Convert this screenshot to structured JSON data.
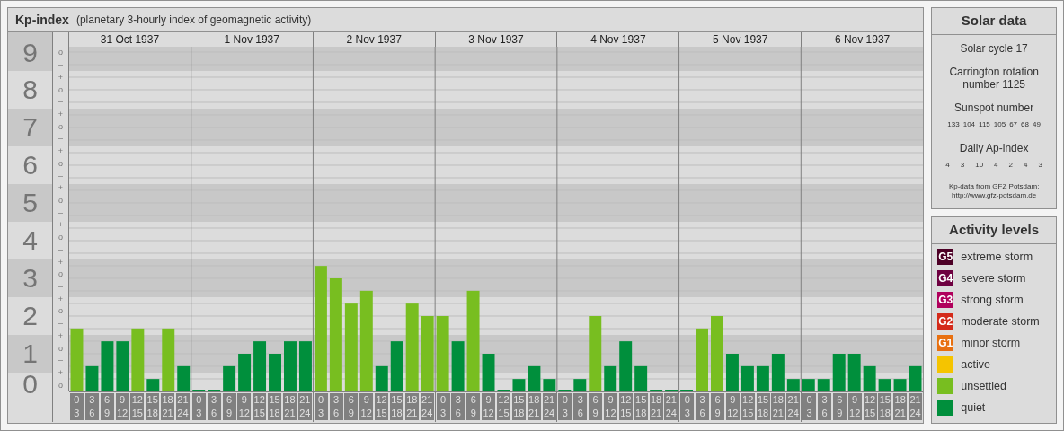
{
  "chart_panel": {
    "title": "Kp-index",
    "subtitle": "(planetary 3-hourly index of geomagnetic activity)",
    "day_labels": [
      "31 Oct 1937",
      "1 Nov 1937",
      "2 Nov 1937",
      "3 Nov 1937",
      "4 Nov 1937",
      "5 Nov 1937",
      "6 Nov 1937"
    ],
    "kp_marks": [
      "o",
      "–",
      "+",
      "o",
      "–",
      "+",
      "o",
      "–",
      "+",
      "o",
      "–",
      "+",
      "o",
      "–",
      "+",
      "o",
      "–",
      "+",
      "o",
      "–",
      "+",
      "o",
      "–",
      "+",
      "o",
      "–",
      "+",
      "o"
    ],
    "chart_data": {
      "type": "bar",
      "grid": true,
      "categories": [
        "0 3",
        "3 6",
        "6 9",
        "9 12",
        "12 15",
        "15 18",
        "18 21",
        "21 24",
        "0 3",
        "3 6",
        "6 9",
        "9 12",
        "12 15",
        "15 18",
        "18 21",
        "21 24",
        "0 3",
        "3 6",
        "6 9",
        "9 12",
        "12 15",
        "15 18",
        "18 21",
        "21 24",
        "0 3",
        "3 6",
        "6 9",
        "9 12",
        "12 15",
        "15 18",
        "18 21",
        "21 24",
        "0 3",
        "3 6",
        "6 9",
        "9 12",
        "12 15",
        "15 18",
        "18 21",
        "21 24",
        "0 3",
        "3 6",
        "6 9",
        "9 12",
        "12 15",
        "15 18",
        "18 21",
        "21 24",
        "0 3",
        "3 6",
        "6 9",
        "9 12",
        "12 15",
        "15 18",
        "18 21",
        "21 24"
      ],
      "series": [
        {
          "color": "#008f3c",
          "values": [
            null,
            0.67,
            1.33,
            1.33,
            null,
            0.33,
            null,
            0.67,
            0,
            0,
            0.67,
            1,
            1.33,
            1,
            1.33,
            1.33,
            null,
            null,
            null,
            null,
            0.67,
            1.33,
            null,
            null,
            null,
            1.33,
            null,
            1,
            0,
            0.33,
            0.67,
            0.33,
            0,
            0.33,
            null,
            0.67,
            1.33,
            0.67,
            0,
            0,
            0,
            null,
            null,
            1,
            0.67,
            0.67,
            1,
            0.33,
            0.33,
            0.33,
            1,
            1,
            0.67,
            0.33,
            0.33,
            0.67
          ]
        },
        {
          "color": "#78be20",
          "values": [
            1.67,
            null,
            null,
            null,
            1.67,
            null,
            1.67,
            null,
            null,
            null,
            null,
            null,
            null,
            null,
            null,
            null,
            3.33,
            3,
            2.33,
            2.67,
            null,
            null,
            2.33,
            2,
            2,
            null,
            2.67,
            null,
            null,
            null,
            null,
            null,
            null,
            null,
            2,
            null,
            null,
            null,
            null,
            null,
            null,
            1.67,
            2,
            null,
            null,
            null,
            null,
            null,
            null,
            null,
            null,
            null,
            null,
            null,
            null,
            null
          ]
        }
      ],
      "ylim": [
        0,
        9
      ],
      "yticks": [
        {
          "value": 9,
          "label": "9"
        },
        {
          "value": 8,
          "label": "8"
        },
        {
          "value": 7,
          "label": "7"
        },
        {
          "value": 6,
          "label": "6"
        },
        {
          "value": 5,
          "label": "5"
        },
        {
          "value": 4,
          "label": "4"
        },
        {
          "value": 3,
          "label": "3"
        },
        {
          "value": 2,
          "label": "2"
        },
        {
          "value": 1,
          "label": "1"
        },
        {
          "value": 0,
          "label": "0"
        }
      ]
    }
  },
  "solar_data": {
    "title": "Solar data",
    "cycle": "Solar cycle 17",
    "carrington": "Carrington rotation number 1125",
    "sunspot_label": "Sunspot number",
    "sunspot_values": [
      "133",
      "104",
      "115",
      "105",
      "67",
      "68",
      "49"
    ],
    "ap_label": "Daily Ap-index",
    "ap_values": [
      "4",
      "3",
      "10",
      "4",
      "2",
      "4",
      "3"
    ],
    "source": "Kp-data from GFZ Potsdam:",
    "source_url": "http://www.gfz-potsdam.de"
  },
  "activity_levels": {
    "title": "Activity levels",
    "items": [
      {
        "badge": "G5",
        "label": "extreme storm",
        "color": "#4d0026"
      },
      {
        "badge": "G4",
        "label": "severe storm",
        "color": "#6e0040"
      },
      {
        "badge": "G3",
        "label": "strong storm",
        "color": "#b0005c"
      },
      {
        "badge": "G2",
        "label": "moderate storm",
        "color": "#d42a1a"
      },
      {
        "badge": "G1",
        "label": "minor storm",
        "color": "#e87010"
      },
      {
        "label": "active",
        "color": "#f5c400"
      },
      {
        "label": "unsettled",
        "color": "#78be20"
      },
      {
        "label": "quiet",
        "color": "#008f3c"
      }
    ]
  }
}
